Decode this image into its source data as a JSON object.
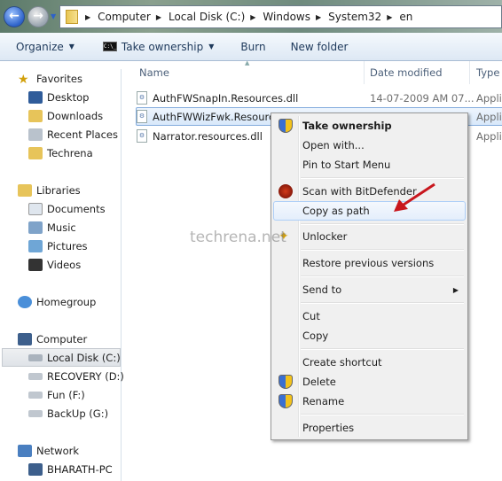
{
  "address": {
    "crumbs": [
      "Computer",
      "Local Disk (C:)",
      "Windows",
      "System32",
      "en"
    ]
  },
  "toolbar": {
    "organize": "Organize",
    "take_ownership": "Take ownership",
    "burn": "Burn",
    "new_folder": "New folder"
  },
  "sidebar": {
    "groups": [
      {
        "head": "Favorites",
        "items": [
          "Desktop",
          "Downloads",
          "Recent Places",
          "Techrena"
        ]
      },
      {
        "head": "Libraries",
        "items": [
          "Documents",
          "Music",
          "Pictures",
          "Videos"
        ]
      },
      {
        "head": "Homegroup",
        "items": []
      },
      {
        "head": "Computer",
        "items": [
          "Local Disk (C:)",
          "RECOVERY (D:)",
          "Fun (F:)",
          "BackUp (G:)"
        ],
        "selected": "Local Disk (C:)"
      },
      {
        "head": "Network",
        "items": [
          "BHARATH-PC"
        ]
      }
    ]
  },
  "columns": {
    "name": "Name",
    "date": "Date modified",
    "type": "Type"
  },
  "files": [
    {
      "name": "AuthFWSnapIn.Resources.dll",
      "date": "14-07-2009 AM 07...",
      "type": "Appli"
    },
    {
      "name": "AuthFWWizFwk.Resources.dll",
      "date": "",
      "type": "Appli",
      "selected": true
    },
    {
      "name": "Narrator.resources.dll",
      "date": "",
      "type": "Appli"
    }
  ],
  "context_menu": {
    "take_ownership": "Take ownership",
    "open_with": "Open with...",
    "pin": "Pin to Start Menu",
    "scan": "Scan with BitDefender",
    "copy_path": "Copy as path",
    "unlocker": "Unlocker",
    "restore": "Restore previous versions",
    "send_to": "Send to",
    "cut": "Cut",
    "copy": "Copy",
    "create_shortcut": "Create shortcut",
    "delete": "Delete",
    "rename": "Rename",
    "properties": "Properties"
  },
  "watermark": "techrena.net",
  "colors": {
    "accent": "#2d62c9",
    "arrow": "#c8161d"
  }
}
